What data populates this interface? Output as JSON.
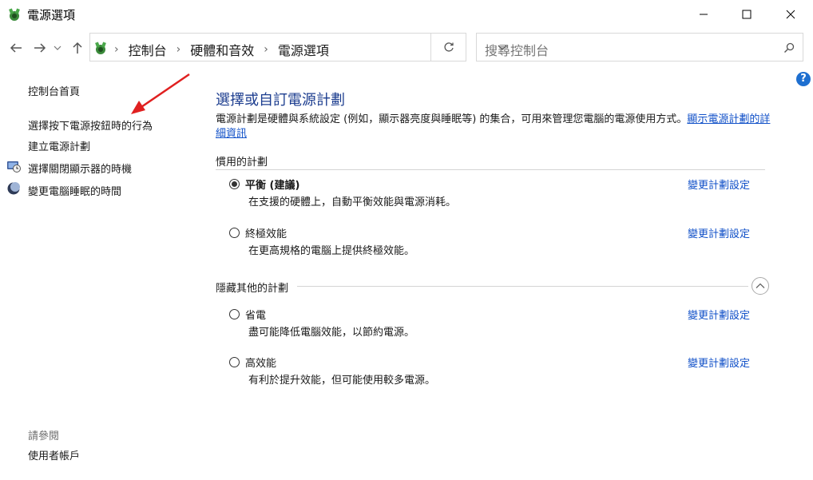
{
  "window": {
    "title": "電源選項"
  },
  "address": {
    "crumbs": [
      "控制台",
      "硬體和音效",
      "電源選項"
    ]
  },
  "search": {
    "placeholder": "搜尋控制台"
  },
  "help": {
    "label": "?"
  },
  "left_nav": {
    "home": "控制台首頁",
    "links": [
      "選擇按下電源按鈕時的行為",
      "建立電源計劃",
      "選擇關閉顯示器的時機",
      "變更電腦睡眠的時間"
    ],
    "see_also_heading": "請參閱",
    "see_also_links": [
      "使用者帳戶"
    ]
  },
  "main": {
    "title": "選擇或自訂電源計劃",
    "description": "電源計劃是硬體與系統設定 (例如，顯示器亮度與睡眠等) 的集合，可用來管理您電腦的電源使用方式。",
    "description_link_1": "顯示電源計劃的詳",
    "description_link_2": "細資訊",
    "preferred_heading": "慣用的計劃",
    "hidden_heading": "隱藏其他的計劃",
    "preferred_plans": [
      {
        "name": "平衡 (建議)",
        "desc": "在支援的硬體上，自動平衡效能與電源消耗。",
        "link": "變更計劃設定",
        "selected": true
      },
      {
        "name": "終極效能",
        "desc": "在更高規格的電腦上提供終極效能。",
        "link": "變更計劃設定",
        "selected": false
      }
    ],
    "hidden_plans": [
      {
        "name": "省電",
        "desc": "盡可能降低電腦效能，以節約電源。",
        "link": "變更計劃設定",
        "selected": false
      },
      {
        "name": "高效能",
        "desc": "有利於提升效能，但可能使用較多電源。",
        "link": "變更計劃設定",
        "selected": false
      }
    ]
  },
  "colors": {
    "title_blue": "#1c3d8f",
    "link_blue": "#1050c8",
    "annotation_red": "#e02020"
  }
}
